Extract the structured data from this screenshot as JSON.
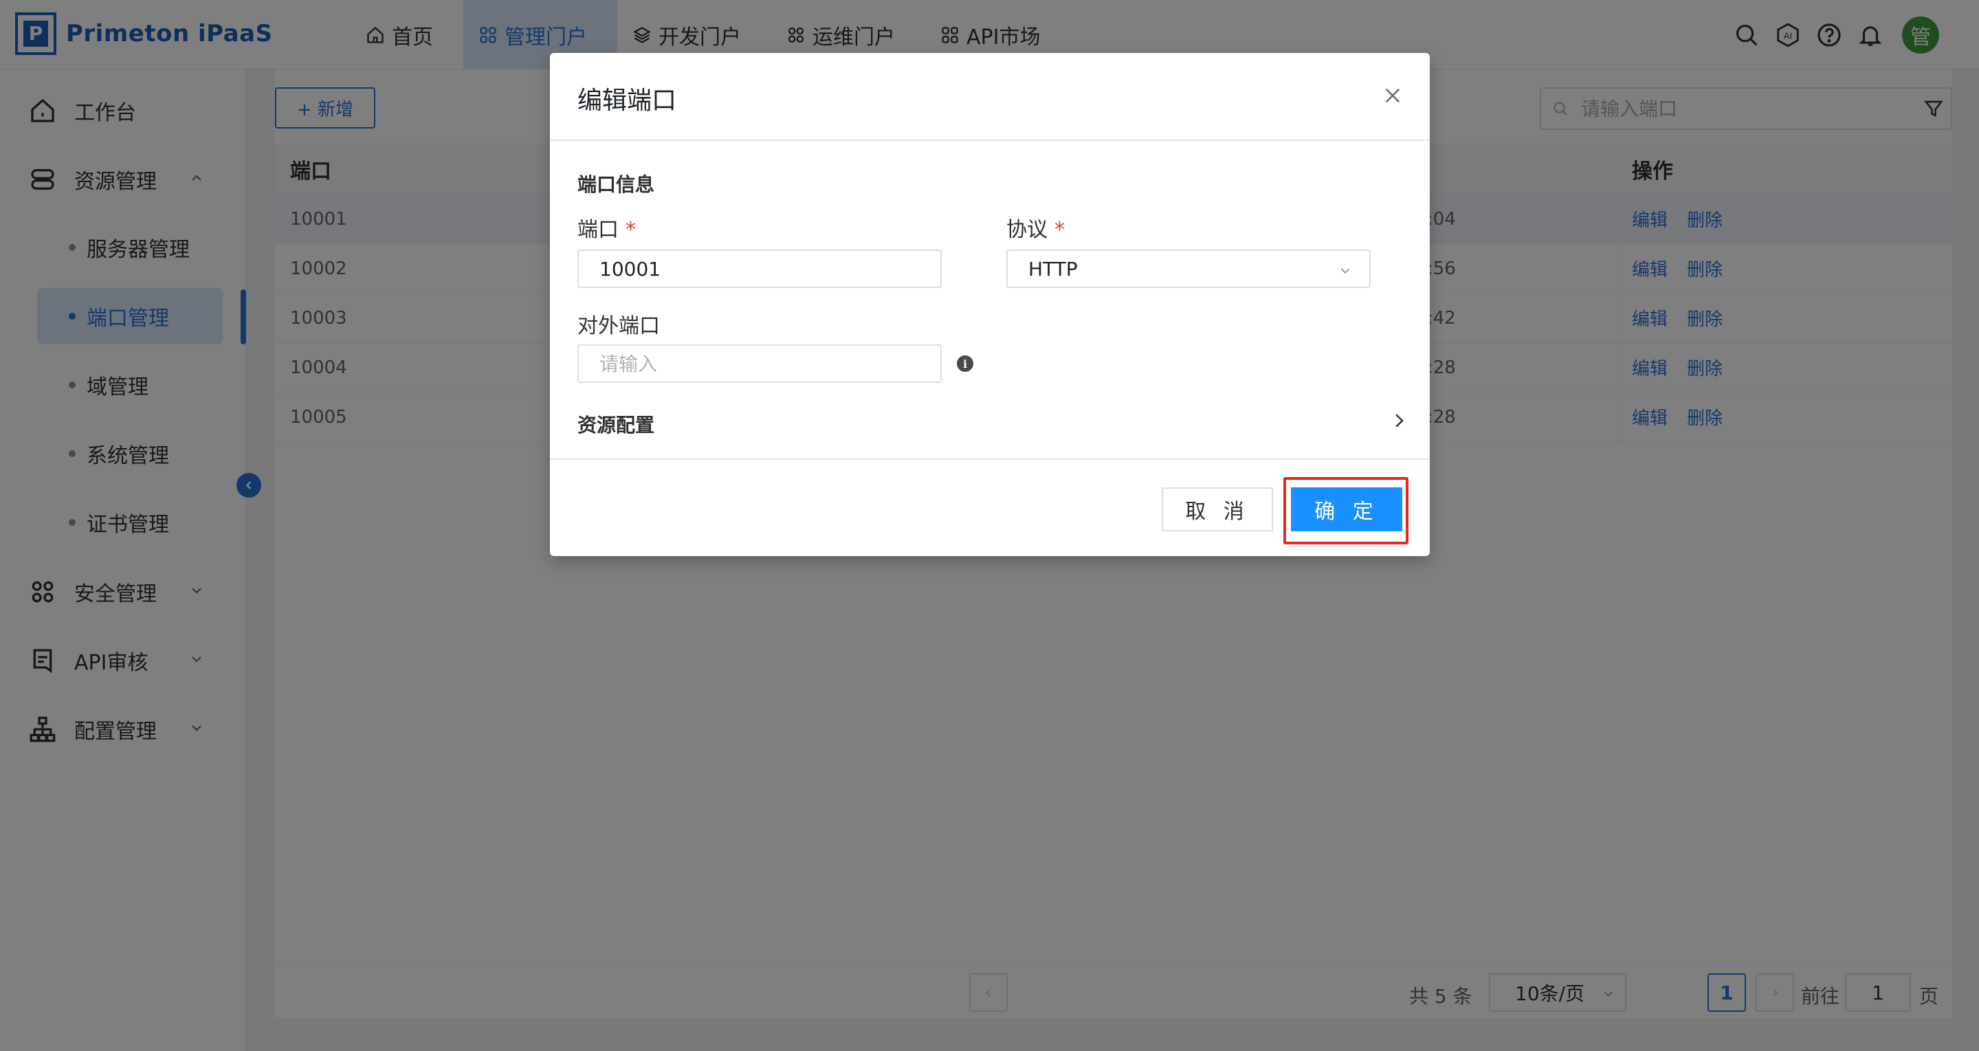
{
  "app": {
    "title": "Primeton iPaaS",
    "logo_letter": "P",
    "brand_color": "#1a5fb4",
    "accent_color": "#2a71d6"
  },
  "nav": {
    "items": [
      {
        "label": "首页",
        "icon": "home-icon",
        "active": false
      },
      {
        "label": "管理门户",
        "icon": "grid-icon",
        "active": true
      },
      {
        "label": "开发门户",
        "icon": "layers-icon",
        "active": false
      },
      {
        "label": "运维门户",
        "icon": "apps-icon",
        "active": false
      },
      {
        "label": "API市场",
        "icon": "apps-icon",
        "active": false
      }
    ]
  },
  "header_tools": {
    "icons": [
      "search-icon",
      "ai-icon",
      "help-icon",
      "bell-icon"
    ],
    "avatar_text": "管",
    "ai_label": "AI"
  },
  "sidebar": {
    "items": [
      {
        "label": "工作台",
        "icon": "home-icon"
      },
      {
        "label": "资源管理",
        "icon": "server-icon",
        "expanded": true
      },
      {
        "label": "安全管理",
        "icon": "apps-icon",
        "expanded": false
      },
      {
        "label": "API审核",
        "icon": "audit-icon",
        "expanded": false
      },
      {
        "label": "配置管理",
        "icon": "sitemap-icon",
        "expanded": false
      }
    ],
    "sub_items": [
      {
        "label": "服务器管理",
        "active": false
      },
      {
        "label": "端口管理",
        "active": true
      },
      {
        "label": "域管理",
        "active": false
      },
      {
        "label": "系统管理",
        "active": false
      },
      {
        "label": "证书管理",
        "active": false
      }
    ]
  },
  "toolbar": {
    "add_label": "+ 新增",
    "search_placeholder": "请输入端口"
  },
  "table": {
    "headers": {
      "port": "端口",
      "actions": "操作"
    },
    "rows": [
      {
        "port": "10001",
        "time_suffix": ":04",
        "edit": "编辑",
        "delete": "删除"
      },
      {
        "port": "10002",
        "time_suffix": ":56",
        "edit": "编辑",
        "delete": "删除"
      },
      {
        "port": "10003",
        "time_suffix": ":42",
        "edit": "编辑",
        "delete": "删除"
      },
      {
        "port": "10004",
        "time_suffix": ":28",
        "edit": "编辑",
        "delete": "删除"
      },
      {
        "port": "10005",
        "time_suffix": ":28",
        "edit": "编辑",
        "delete": "删除"
      }
    ]
  },
  "pagination": {
    "total": "共 5 条",
    "page_size": "10条/页",
    "current_page": "1",
    "goto_prefix": "前往",
    "goto_value": "1",
    "goto_suffix": "页"
  },
  "modal": {
    "title": "编辑端口",
    "section_title": "端口信息",
    "port_label": "端口",
    "port_value": "10001",
    "protocol_label": "协议",
    "protocol_value": "HTTP",
    "required_mark": "*",
    "external_port_label": "对外端口",
    "external_port_placeholder": "请输入",
    "info_mark": "i",
    "resource_config_label": "资源配置",
    "cancel_label": "取 消",
    "ok_label": "确 定",
    "highlight_color": "#e8271f",
    "ok_color": "#1890ff"
  }
}
